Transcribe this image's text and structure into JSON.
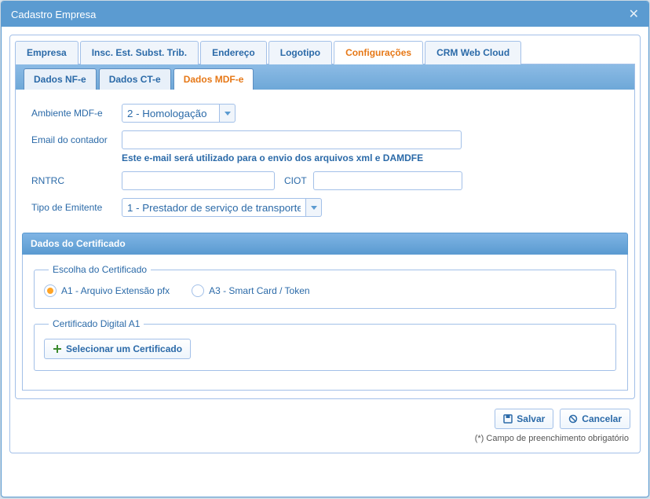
{
  "dialog": {
    "title": "Cadastro Empresa"
  },
  "tabs": {
    "primary": [
      {
        "label": "Empresa"
      },
      {
        "label": "Insc. Est. Subst. Trib."
      },
      {
        "label": "Endereço"
      },
      {
        "label": "Logotipo"
      },
      {
        "label": "Configurações",
        "active": true
      },
      {
        "label": "CRM Web Cloud"
      }
    ],
    "secondary": [
      {
        "label": "Dados NF-e"
      },
      {
        "label": "Dados CT-e"
      },
      {
        "label": "Dados MDF-e",
        "active": true
      }
    ]
  },
  "form": {
    "ambiente_label": "Ambiente MDF-e",
    "ambiente_value": "2 - Homologação",
    "email_label": "Email do contador",
    "email_value": "",
    "email_helper": "Este e-mail será utilizado para o envio dos arquivos xml e DAMDFE",
    "rntrc_label": "RNTRC",
    "rntrc_value": "",
    "ciot_label": "CIOT",
    "ciot_value": "",
    "tipo_emitente_label": "Tipo de Emitente",
    "tipo_emitente_value": "1 - Prestador de serviço de transporte"
  },
  "certificado": {
    "section_title": "Dados do Certificado",
    "escolha_legend": "Escolha do Certificado",
    "radio_a1": "A1 - Arquivo Extensão pfx",
    "radio_a3": "A3 - Smart Card / Token",
    "a1_legend": "Certificado Digital A1",
    "select_btn": "Selecionar um Certificado"
  },
  "footer": {
    "save": "Salvar",
    "cancel": "Cancelar",
    "required_note": "(*) Campo de preenchimento obrigatório"
  }
}
